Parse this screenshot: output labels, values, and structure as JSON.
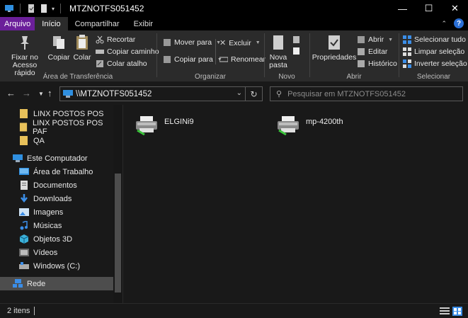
{
  "window": {
    "title": "MTZNOTFS051452",
    "minimize": "—",
    "maximize": "☐",
    "close": "✕"
  },
  "ribbon_tabs": [
    "Arquivo",
    "Início",
    "Compartilhar",
    "Exibir"
  ],
  "ribbon": {
    "clipboard": {
      "label": "Área de Transferência",
      "pin": "Fixar no Acesso rápido",
      "copy": "Copiar",
      "paste": "Colar",
      "cut": "Recortar",
      "copy_path": "Copiar caminho",
      "paste_shortcut": "Colar atalho"
    },
    "organize": {
      "label": "Organizar",
      "move_to": "Mover para",
      "copy_to": "Copiar para",
      "delete": "Excluir",
      "rename": "Renomear"
    },
    "new": {
      "label": "Novo",
      "new_folder": "Nova pasta"
    },
    "open": {
      "label": "Abrir",
      "properties": "Propriedades",
      "open": "Abrir",
      "edit": "Editar",
      "history": "Histórico"
    },
    "select": {
      "label": "Selecionar",
      "select_all": "Selecionar tudo",
      "select_none": "Limpar seleção",
      "invert": "Inverter seleção"
    }
  },
  "address": {
    "path": "\\\\MTZNOTFS051452",
    "search_placeholder": "Pesquisar em MTZNOTFS051452"
  },
  "nav": {
    "items": [
      {
        "label": "LINX POSTOS POS",
        "type": "folder"
      },
      {
        "label": "LINX POSTOS POS PAF",
        "type": "folder"
      },
      {
        "label": "QA",
        "type": "folder"
      },
      {
        "label": "Este Computador",
        "type": "pc"
      },
      {
        "label": "Área de Trabalho",
        "type": "desktop"
      },
      {
        "label": "Documentos",
        "type": "docs"
      },
      {
        "label": "Downloads",
        "type": "downloads"
      },
      {
        "label": "Imagens",
        "type": "images"
      },
      {
        "label": "Músicas",
        "type": "music"
      },
      {
        "label": "Objetos 3D",
        "type": "objects3d"
      },
      {
        "label": "Vídeos",
        "type": "videos"
      },
      {
        "label": "Windows (C:)",
        "type": "drive"
      },
      {
        "label": "Rede",
        "type": "network"
      }
    ]
  },
  "content": {
    "items": [
      {
        "name": "ELGINi9"
      },
      {
        "name": "mp-4200th"
      }
    ]
  },
  "status": {
    "count": "2 itens"
  },
  "colors": {
    "file_tab": "#6b1f9a",
    "accent_blue": "#2a6fd6",
    "folder": "#e8c15a"
  }
}
